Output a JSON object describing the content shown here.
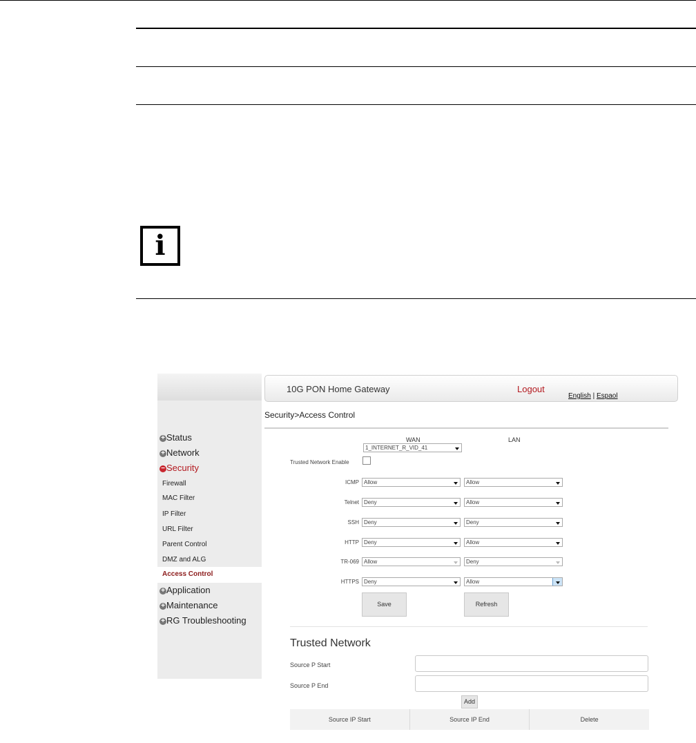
{
  "gateway": {
    "title": "10G PON Home Gateway",
    "logout": "Logout",
    "lang_english": "English",
    "lang_sep": " | ",
    "lang_espanol": "Espaol",
    "breadcrumb": "Security>Access Control"
  },
  "sidebar": {
    "items": [
      {
        "label": "Status",
        "sign": "+"
      },
      {
        "label": "Network",
        "sign": "+"
      },
      {
        "label": "Security",
        "sign": "−"
      },
      {
        "label": "Application",
        "sign": "+"
      },
      {
        "label": "Maintenance",
        "sign": "+"
      },
      {
        "label": "RG Troubleshooting",
        "sign": "+"
      }
    ],
    "sub": [
      "Firewall",
      "MAC Filter",
      "IP Filter",
      "URL Filter",
      "Parent Control",
      "DMZ and ALG",
      "Access Control"
    ]
  },
  "access": {
    "wan_header": "WAN",
    "lan_header": "LAN",
    "wan_select": "1_INTERNET_R_VID_41",
    "trusted_enable": "Trusted Network Enable",
    "rows": [
      {
        "label": "ICMP",
        "wan": "Allow",
        "lan": "Allow"
      },
      {
        "label": "Telnet",
        "wan": "Deny",
        "lan": "Allow"
      },
      {
        "label": "SSH",
        "wan": "Deny",
        "lan": "Deny"
      },
      {
        "label": "HTTP",
        "wan": "Deny",
        "lan": "Allow"
      },
      {
        "label": "TR-069",
        "wan": "Allow",
        "lan": "Deny"
      },
      {
        "label": "HTTPS",
        "wan": "Deny",
        "lan": "Allow"
      }
    ],
    "save": "Save",
    "refresh": "Refresh"
  },
  "trusted": {
    "title": "Trusted Network",
    "start_label": "Source P Start",
    "end_label": "Source P End",
    "start_value": "",
    "end_value": "",
    "add": "Add",
    "columns": [
      "Source IP Start",
      "Source IP End",
      "Delete"
    ]
  }
}
